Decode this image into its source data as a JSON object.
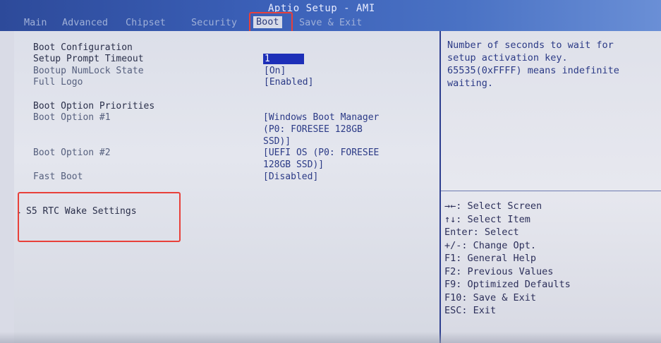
{
  "header": {
    "title": "Aptio Setup - AMI",
    "tabs": [
      {
        "label": "Main"
      },
      {
        "label": "Advanced"
      },
      {
        "label": "Chipset"
      },
      {
        "label": "Security"
      },
      {
        "label": "Boot"
      },
      {
        "label": "Save & Exit"
      }
    ],
    "active_tab": "Boot"
  },
  "settings": {
    "boot_configuration": "Boot Configuration",
    "setup_prompt_timeout": {
      "label": "Setup Prompt Timeout",
      "value": "1"
    },
    "bootup_numlock": {
      "label": "Bootup NumLock State",
      "value": "[On]"
    },
    "full_logo": {
      "label": "Full Logo",
      "value": "[Enabled]"
    },
    "boot_option_priorities": "Boot Option Priorities",
    "boot_option_1": {
      "label": "Boot Option #1",
      "value_lines": [
        "[Windows Boot Manager",
        "(P0: FORESEE 128GB",
        "SSD)]"
      ]
    },
    "boot_option_2": {
      "label": "Boot Option #2",
      "value_lines": [
        "[UEFI OS (P0: FORESEE",
        "128GB SSD)]"
      ]
    },
    "fast_boot": {
      "label": "Fast Boot",
      "value": "[Disabled]"
    },
    "s5_rtc": {
      "label": "S5 RTC Wake Settings"
    }
  },
  "help": {
    "lines": [
      "Number of seconds to wait for",
      "setup activation key.",
      "65535(0xFFFF) means indefinite",
      "waiting."
    ]
  },
  "keys": [
    "→←: Select Screen",
    "↑↓: Select Item",
    "Enter: Select",
    "+/-: Change Opt.",
    "F1: General Help",
    "F2: Previous Values",
    "F9: Optimized Defaults",
    "F10: Save & Exit",
    "ESC: Exit"
  ],
  "colors": {
    "header_blue": "#3b60b8",
    "selection_blue": "#1d2fb8",
    "highlight_red": "#e8403a",
    "value_text": "#2b3a86"
  }
}
